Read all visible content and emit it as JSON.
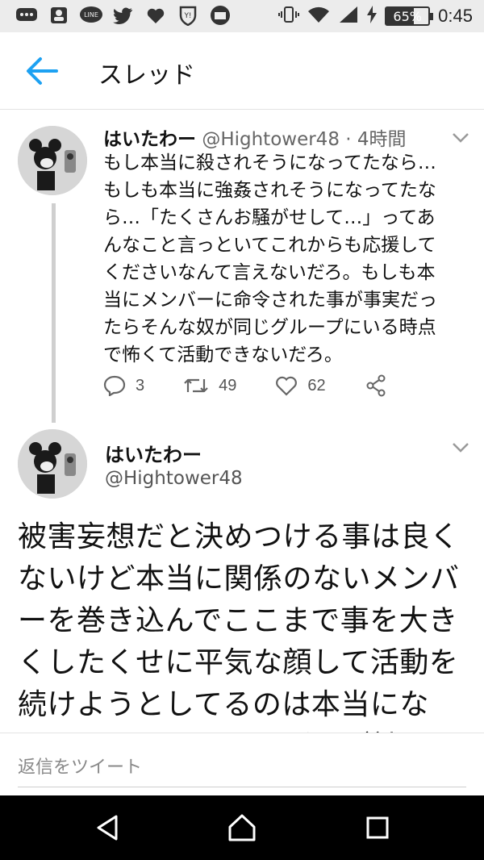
{
  "status_bar": {
    "battery": "65%",
    "time": "0:45",
    "icons": [
      "chat-icon",
      "contacts-icon",
      "line-icon",
      "twitter-icon",
      "heart-icon",
      "yahoo-icon",
      "app-icon",
      "vibrate-icon",
      "wifi-icon",
      "signal-icon",
      "charging-icon"
    ]
  },
  "header": {
    "title": "スレッド",
    "back_icon": "back-arrow-icon"
  },
  "tweet1": {
    "name": "はいたわー",
    "meta": "@Hightower48 · 4時間",
    "lines": [
      "もし本当に殺されそうになってたなら…",
      "もしも本当に強姦されそうになってたな",
      "ら…「たくさんお騒がせして…」ってあ",
      "んなこと言っといてこれからも応援して",
      "くださいなんて言えないだろ。もしも本",
      "当にメンバーに命令された事が事実だっ",
      "たらそんな奴が同じグループにいる時点",
      "で怖くて活動できないだろ。"
    ],
    "replies": "3",
    "retweets": "49",
    "likes": "62"
  },
  "tweet2": {
    "name": "はいたわー",
    "handle": "@Hightower48",
    "lines": [
      "被害妄想だと決めつける事は良く",
      "ないけど本当に関係のないメンバ",
      "ーを巻き込んでここまで事を大き",
      "くしたくせに平気な顔して活動を",
      "続けようとしてるのは本当にな",
      "い。ただもしもメンバーが計画し"
    ]
  },
  "reply": {
    "placeholder": "返信をツイート"
  }
}
